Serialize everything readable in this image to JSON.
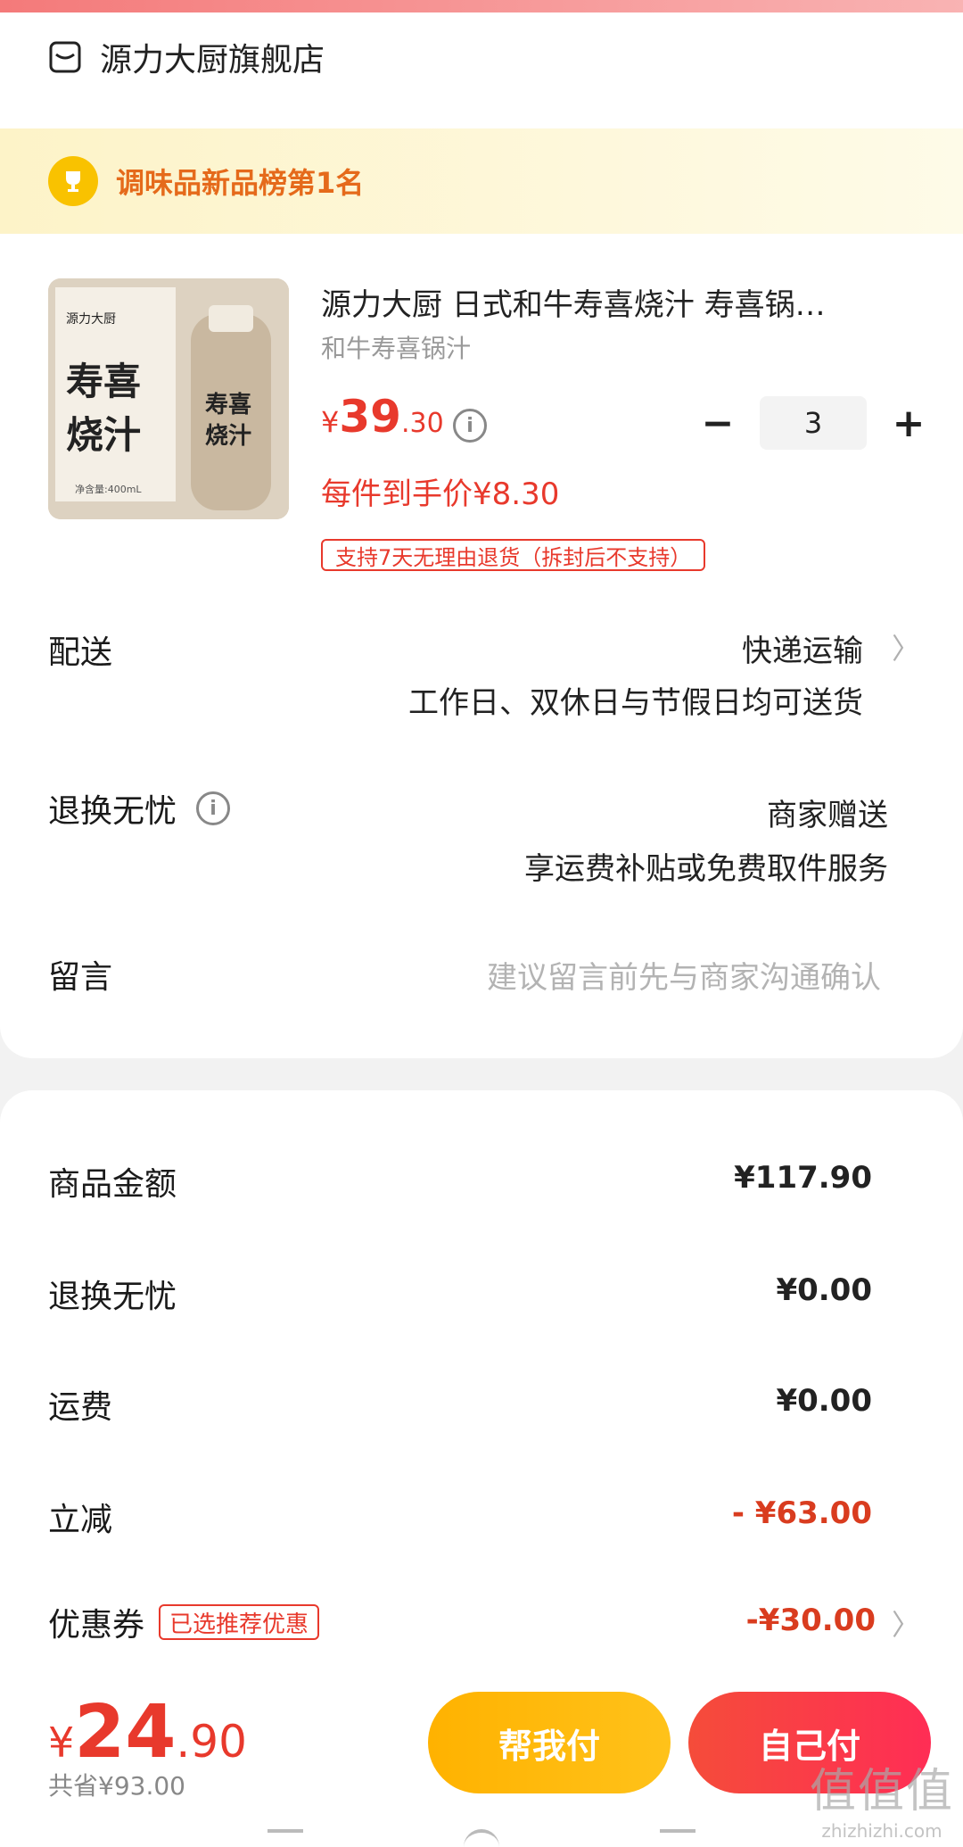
{
  "store": {
    "name": "源力大厨旗舰店",
    "icon": "shop-icon"
  },
  "rank_banner": {
    "text": "调味品新品榜第1名",
    "icon": "trophy-icon"
  },
  "product": {
    "title": "源力大厨 日式和牛寿喜烧汁 寿喜锅…",
    "subtitle": "和牛寿喜锅汁",
    "price_yen": "¥",
    "price_int": "39",
    "price_dec": ".30",
    "unit_price": "每件到手价¥8.30",
    "quantity": "3",
    "return_tag": "支持7天无理由退货（拆封后不支持）",
    "image_text": {
      "brand": "源力大厨",
      "big": "寿喜烧汁",
      "volume": "净含量:400mL"
    }
  },
  "delivery": {
    "label": "配送",
    "method": "快递运输",
    "note": "工作日、双休日与节假日均可送货"
  },
  "worry_free": {
    "label": "退换无忧",
    "value": "商家赠送",
    "note": "享运费补贴或免费取件服务"
  },
  "message": {
    "label": "留言",
    "placeholder": "建议留言前先与商家沟通确认"
  },
  "summary": {
    "goods_label": "商品金额",
    "goods_value": "¥117.90",
    "worry_label": "退换无忧",
    "worry_value": "¥0.00",
    "shipping_label": "运费",
    "shipping_value": "¥0.00",
    "discount_label": "立减",
    "discount_value": "- ¥63.00",
    "coupon_label": "优惠券",
    "coupon_tag": "已选推荐优惠",
    "coupon_value": "-¥30.00"
  },
  "bottom": {
    "total_yen": "¥",
    "total_int": "24",
    "total_dec": ".90",
    "saved": "共省¥93.00",
    "help_pay": "帮我付",
    "self_pay": "自己付"
  },
  "watermark": {
    "big": "值值值",
    "small": "zhizhizhi.com"
  },
  "colors": {
    "accent_red": "#e8392c",
    "yellow_button": "#ffb200",
    "red_button": "#f54c3a"
  }
}
